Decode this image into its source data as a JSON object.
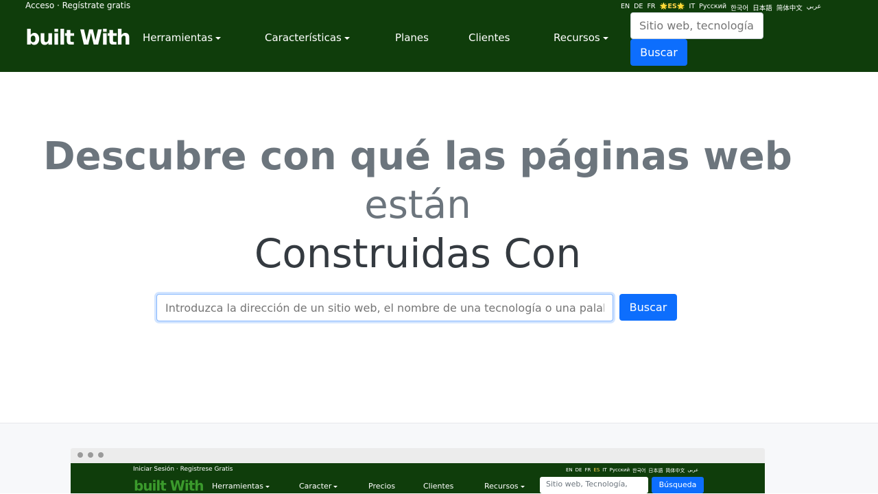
{
  "header": {
    "top_links": {
      "login": "Acceso",
      "separator": " · ",
      "signup": "Regístrate gratis"
    },
    "languages": [
      "EN",
      "DE",
      "FR",
      "🌟ES🌟",
      "IT",
      "Русский",
      "한국어",
      "日本語",
      "简体中文",
      "عربي"
    ],
    "active_language": "🌟ES🌟",
    "logo": "built With",
    "nav": [
      {
        "label": "Herramientas",
        "dropdown": true
      },
      {
        "label": "Características",
        "dropdown": true
      },
      {
        "label": "Planes",
        "dropdown": false
      },
      {
        "label": "Clientes",
        "dropdown": false
      },
      {
        "label": "Recursos",
        "dropdown": true
      }
    ],
    "search": {
      "placeholder": "Sitio web, tecnología",
      "button": "Buscar"
    }
  },
  "hero": {
    "line1": "Descubre con qué las páginas web",
    "line2": "están",
    "line3": "Construidas Con",
    "search": {
      "placeholder": "Introduzca la dirección de un sitio web, el nombre de una tecnología o una palabra clave",
      "button": "Buscar"
    }
  },
  "preview": {
    "top_links": "Iniciar Sesión · Registrese Gratis",
    "languages": [
      "EN",
      "DE",
      "FR",
      "ES",
      "IT",
      "Русский",
      "한국어",
      "日本語",
      "简体中文",
      "عربي"
    ],
    "active_language": "ES",
    "logo": "built With",
    "nav": [
      {
        "label": "Herramientas",
        "dropdown": true
      },
      {
        "label": "Caracter",
        "dropdown": true
      },
      {
        "label": "Precios",
        "dropdown": false
      },
      {
        "label": "Clientes",
        "dropdown": false
      },
      {
        "label": "Recursos",
        "dropdown": true
      }
    ],
    "search_placeholder": "Sitio web, Tecnología,",
    "search_button": "Búsqueda"
  },
  "colors": {
    "header_bg": "#0f3d0b",
    "accent": "#0d6efd",
    "hero_gray": "#6c757d",
    "hero_dark": "#343a40"
  }
}
